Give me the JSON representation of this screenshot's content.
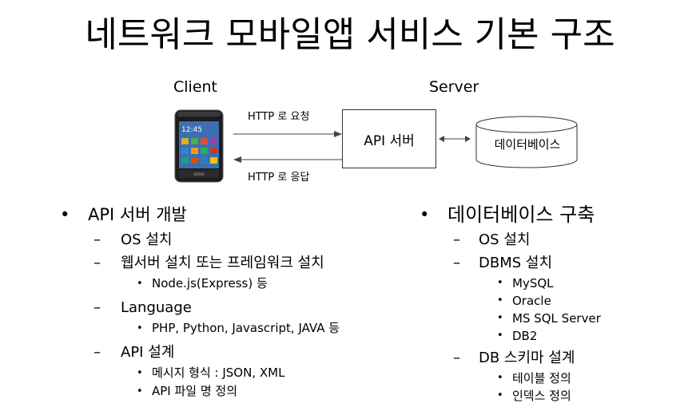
{
  "title": "네트워크 모바일앱 서비스 기본 구조",
  "diagram": {
    "client_label": "Client",
    "server_label": "Server",
    "request_label": "HTTP 로 요청",
    "response_label": "HTTP 로 응답",
    "api_server_label": "API 서버",
    "database_label": "데이터베이스",
    "phone_icon": "smartphone-icon"
  },
  "left_list": {
    "title": "API 서버 개발",
    "items": [
      {
        "label": "OS 설치",
        "subitems": []
      },
      {
        "label": "웹서버 설치 또는 프레임워크 설치",
        "subitems": [
          "Node.js(Express) 등"
        ]
      },
      {
        "label": "Language",
        "subitems": [
          "PHP, Python, Javascript, JAVA 등"
        ]
      },
      {
        "label": "API 설계",
        "subitems": [
          "메시지 형식 : JSON, XML",
          "API 파일 명 정의"
        ]
      }
    ]
  },
  "right_list": {
    "title": "데이터베이스 구축",
    "items": [
      {
        "label": "OS 설치",
        "subitems": []
      },
      {
        "label": "DBMS 설치",
        "subitems": [
          "MySQL",
          "Oracle",
          "MS SQL Server",
          "DB2"
        ]
      },
      {
        "label": "DB 스키마 설계",
        "subitems": [
          "테이블 정의",
          "인덱스 정의"
        ]
      }
    ]
  }
}
